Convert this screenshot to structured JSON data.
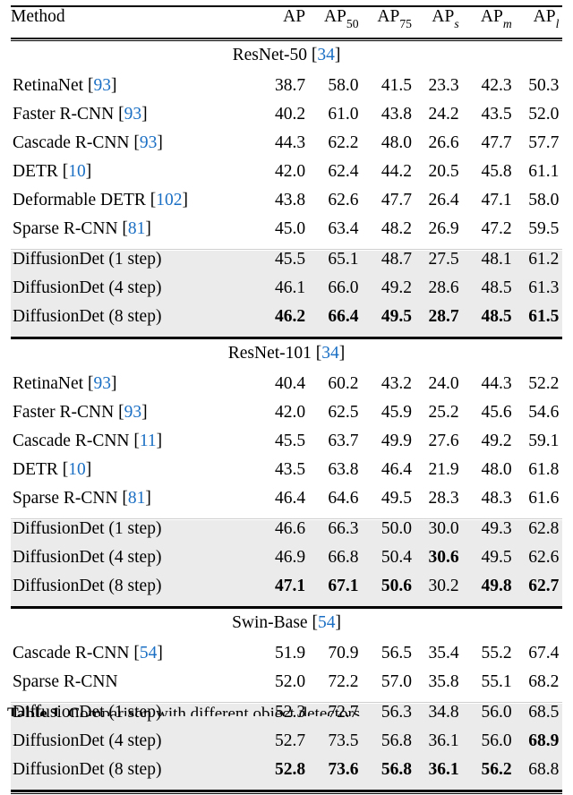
{
  "table": {
    "columns": [
      {
        "key": "method",
        "label": "Method",
        "align": "left"
      },
      {
        "key": "ap",
        "label": "AP",
        "sub": "",
        "sub_italic": false
      },
      {
        "key": "ap50",
        "label": "AP",
        "sub": "50",
        "sub_italic": false
      },
      {
        "key": "ap75",
        "label": "AP",
        "sub": "75",
        "sub_italic": false
      },
      {
        "key": "aps",
        "label": "AP",
        "sub": "s",
        "sub_italic": true
      },
      {
        "key": "apm",
        "label": "AP",
        "sub": "m",
        "sub_italic": true
      },
      {
        "key": "apl",
        "label": "AP",
        "sub": "l",
        "sub_italic": true
      }
    ],
    "sections": [
      {
        "label": "ResNet-50",
        "citation": "34",
        "rows": [
          {
            "method": "RetinaNet",
            "citation": "93",
            "highlight": false,
            "values": [
              "38.7",
              "58.0",
              "41.5",
              "23.3",
              "42.3",
              "50.3"
            ],
            "bold": [
              false,
              false,
              false,
              false,
              false,
              false
            ]
          },
          {
            "method": "Faster R-CNN",
            "citation": "93",
            "highlight": false,
            "values": [
              "40.2",
              "61.0",
              "43.8",
              "24.2",
              "43.5",
              "52.0"
            ],
            "bold": [
              false,
              false,
              false,
              false,
              false,
              false
            ]
          },
          {
            "method": "Cascade R-CNN",
            "citation": "93",
            "highlight": false,
            "values": [
              "44.3",
              "62.2",
              "48.0",
              "26.6",
              "47.7",
              "57.7"
            ],
            "bold": [
              false,
              false,
              false,
              false,
              false,
              false
            ]
          },
          {
            "method": "DETR",
            "citation": "10",
            "highlight": false,
            "values": [
              "42.0",
              "62.4",
              "44.2",
              "20.5",
              "45.8",
              "61.1"
            ],
            "bold": [
              false,
              false,
              false,
              false,
              false,
              false
            ]
          },
          {
            "method": "Deformable DETR",
            "citation": "102",
            "highlight": false,
            "values": [
              "43.8",
              "62.6",
              "47.7",
              "26.4",
              "47.1",
              "58.0"
            ],
            "bold": [
              false,
              false,
              false,
              false,
              false,
              false
            ]
          },
          {
            "method": "Sparse R-CNN",
            "citation": "81",
            "highlight": false,
            "values": [
              "45.0",
              "63.4",
              "48.2",
              "26.9",
              "47.2",
              "59.5"
            ],
            "bold": [
              false,
              false,
              false,
              false,
              false,
              false
            ]
          },
          {
            "method": "DiffusionDet (1 step)",
            "citation": null,
            "highlight": true,
            "values": [
              "45.5",
              "65.1",
              "48.7",
              "27.5",
              "48.1",
              "61.2"
            ],
            "bold": [
              false,
              false,
              false,
              false,
              false,
              false
            ]
          },
          {
            "method": "DiffusionDet (4 step)",
            "citation": null,
            "highlight": true,
            "values": [
              "46.1",
              "66.0",
              "49.2",
              "28.6",
              "48.5",
              "61.3"
            ],
            "bold": [
              false,
              false,
              false,
              false,
              false,
              false
            ]
          },
          {
            "method": "DiffusionDet (8 step)",
            "citation": null,
            "highlight": true,
            "values": [
              "46.2",
              "66.4",
              "49.5",
              "28.7",
              "48.5",
              "61.5"
            ],
            "bold": [
              true,
              true,
              true,
              true,
              true,
              true
            ]
          }
        ]
      },
      {
        "label": "ResNet-101",
        "citation": "34",
        "rows": [
          {
            "method": "RetinaNet",
            "citation": "93",
            "highlight": false,
            "values": [
              "40.4",
              "60.2",
              "43.2",
              "24.0",
              "44.3",
              "52.2"
            ],
            "bold": [
              false,
              false,
              false,
              false,
              false,
              false
            ]
          },
          {
            "method": "Faster R-CNN",
            "citation": "93",
            "highlight": false,
            "values": [
              "42.0",
              "62.5",
              "45.9",
              "25.2",
              "45.6",
              "54.6"
            ],
            "bold": [
              false,
              false,
              false,
              false,
              false,
              false
            ]
          },
          {
            "method": "Cascade R-CNN",
            "citation": "11",
            "highlight": false,
            "values": [
              "45.5",
              "63.7",
              "49.9",
              "27.6",
              "49.2",
              "59.1"
            ],
            "bold": [
              false,
              false,
              false,
              false,
              false,
              false
            ]
          },
          {
            "method": "DETR",
            "citation": "10",
            "highlight": false,
            "values": [
              "43.5",
              "63.8",
              "46.4",
              "21.9",
              "48.0",
              "61.8"
            ],
            "bold": [
              false,
              false,
              false,
              false,
              false,
              false
            ]
          },
          {
            "method": "Sparse R-CNN",
            "citation": "81",
            "highlight": false,
            "values": [
              "46.4",
              "64.6",
              "49.5",
              "28.3",
              "48.3",
              "61.6"
            ],
            "bold": [
              false,
              false,
              false,
              false,
              false,
              false
            ]
          },
          {
            "method": "DiffusionDet (1 step)",
            "citation": null,
            "highlight": true,
            "values": [
              "46.6",
              "66.3",
              "50.0",
              "30.0",
              "49.3",
              "62.8"
            ],
            "bold": [
              false,
              false,
              false,
              false,
              false,
              false
            ]
          },
          {
            "method": "DiffusionDet (4 step)",
            "citation": null,
            "highlight": true,
            "values": [
              "46.9",
              "66.8",
              "50.4",
              "30.6",
              "49.5",
              "62.6"
            ],
            "bold": [
              false,
              false,
              false,
              true,
              false,
              false
            ]
          },
          {
            "method": "DiffusionDet (8 step)",
            "citation": null,
            "highlight": true,
            "values": [
              "47.1",
              "67.1",
              "50.6",
              "30.2",
              "49.8",
              "62.7"
            ],
            "bold": [
              true,
              true,
              true,
              false,
              true,
              true
            ]
          }
        ]
      },
      {
        "label": "Swin-Base",
        "citation": "54",
        "rows": [
          {
            "method": "Cascade R-CNN",
            "citation": "54",
            "highlight": false,
            "values": [
              "51.9",
              "70.9",
              "56.5",
              "35.4",
              "55.2",
              "67.4"
            ],
            "bold": [
              false,
              false,
              false,
              false,
              false,
              false
            ]
          },
          {
            "method": "Sparse R-CNN",
            "citation": null,
            "highlight": false,
            "values": [
              "52.0",
              "72.2",
              "57.0",
              "35.8",
              "55.1",
              "68.2"
            ],
            "bold": [
              false,
              false,
              false,
              false,
              false,
              false
            ]
          },
          {
            "method": "DiffusionDet (1 step)",
            "citation": null,
            "highlight": true,
            "values": [
              "52.3",
              "72.7",
              "56.3",
              "34.8",
              "56.0",
              "68.5"
            ],
            "bold": [
              false,
              false,
              false,
              false,
              false,
              false
            ]
          },
          {
            "method": "DiffusionDet (4 step)",
            "citation": null,
            "highlight": true,
            "values": [
              "52.7",
              "73.5",
              "56.8",
              "36.1",
              "56.0",
              "68.9"
            ],
            "bold": [
              false,
              false,
              false,
              false,
              false,
              true
            ]
          },
          {
            "method": "DiffusionDet (8 step)",
            "citation": null,
            "highlight": true,
            "values": [
              "52.8",
              "73.6",
              "56.8",
              "36.1",
              "56.2",
              "68.8"
            ],
            "bold": [
              true,
              true,
              true,
              true,
              true,
              false
            ]
          }
        ]
      }
    ]
  },
  "caption": {
    "label": "Table 1.",
    "text": "Comparison with different object detectors"
  },
  "colors": {
    "citation": "#1a6fc4",
    "highlight_row": "#ebebeb",
    "rule": "#000000",
    "light_rule": "#cfcfcf",
    "text": "#000000",
    "background": "#ffffff"
  }
}
